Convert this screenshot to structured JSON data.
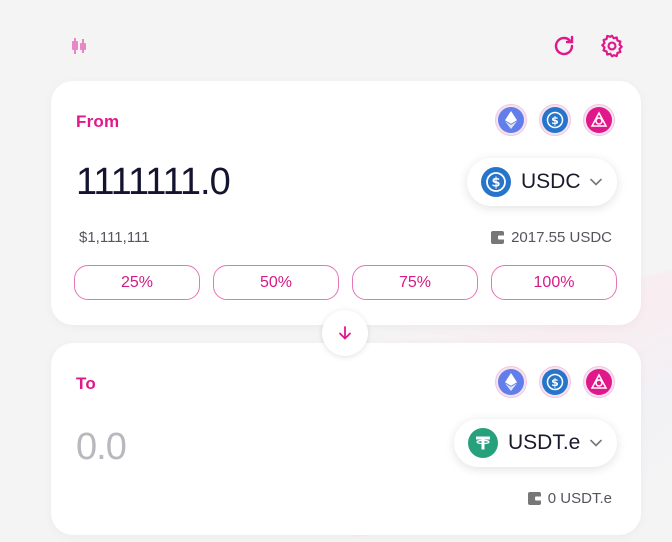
{
  "colors": {
    "accent": "#e0188a",
    "usdc": "#2775ca",
    "usdt": "#26a17b",
    "eth": "#627eea",
    "bnb_like": "#e0188a"
  },
  "toolbar": {
    "chart_icon": "chart-icon",
    "refresh_icon": "refresh-icon",
    "settings_icon": "gear-icon"
  },
  "from": {
    "label": "From",
    "chains": [
      "ethereum-icon",
      "usdc-chain-icon",
      "network-icon"
    ],
    "amount": "1111111.0",
    "token": "USDC",
    "usd_value": "$1,111,111",
    "balance": "2017.55 USDC",
    "percent_buttons": [
      "25%",
      "50%",
      "75%",
      "100%"
    ]
  },
  "to": {
    "label": "To",
    "chains": [
      "ethereum-icon",
      "usdc-chain-icon",
      "network-icon"
    ],
    "amount": "0.0",
    "token": "USDT.e",
    "balance": "0 USDT.e"
  }
}
